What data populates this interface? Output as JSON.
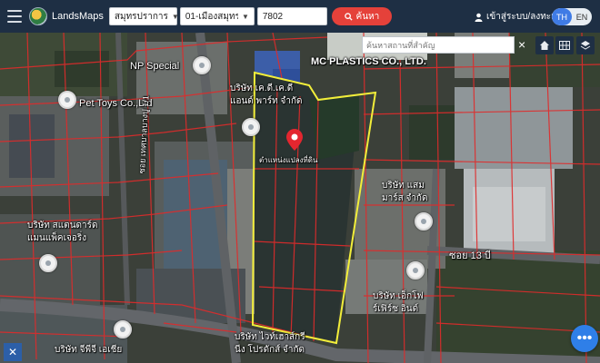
{
  "app": {
    "brand": "LandsMaps"
  },
  "search": {
    "province": "สมุทรปราการ",
    "district": "01-เมืองสมุทรปราการ",
    "parcel_number": "7802",
    "button_label": "ค้นหา"
  },
  "account": {
    "login_label": "เข้าสู่ระบบ/ลงทะเบียน"
  },
  "language": {
    "options": [
      "TH",
      "EN"
    ],
    "active": "TH"
  },
  "map": {
    "place_search_placeholder": "ค้นหาสถานที่สำคัญ",
    "parcel_caption": "ตำแหน่งแปลงที่ดิน",
    "labels": {
      "np_special": "NP Special",
      "pet_toys": "Pet Toys Co.,Ltd",
      "mc_plastics": "MC PLASTICS CO., LTD.",
      "dkd_line1": "บริษัท เค.ดี.เค.ดี",
      "dkd_line2": "แอนด์ พาร์ท จำกัด",
      "road_vertical": "ซอย เทศบาลบางปู 1/1",
      "sam_line1": "บริษัท แสม",
      "sam_line2": "มาร์ส จำกัด",
      "standard_line1": "บริษัท สแตนดาร์ด",
      "standard_line2": "แมนแพ็คเจอริ่ง",
      "soi13": "ซอย 13 บี",
      "ek_line1": "บริษัท เอ็กโฟ",
      "ek_line2": "ร์เฟิร์ซ อินด์",
      "jpa_line1": "บริษัท จีพีจี เอเชีย",
      "white_line1": "บริษัท ไวท์เฮาส์กรี",
      "white_line2": "นีง โปรดักส์ จำกัด"
    },
    "colors": {
      "parcel_outline": "#f2ee3a",
      "lot_lines": "#e02b2b",
      "marker": "#e3262f"
    }
  }
}
